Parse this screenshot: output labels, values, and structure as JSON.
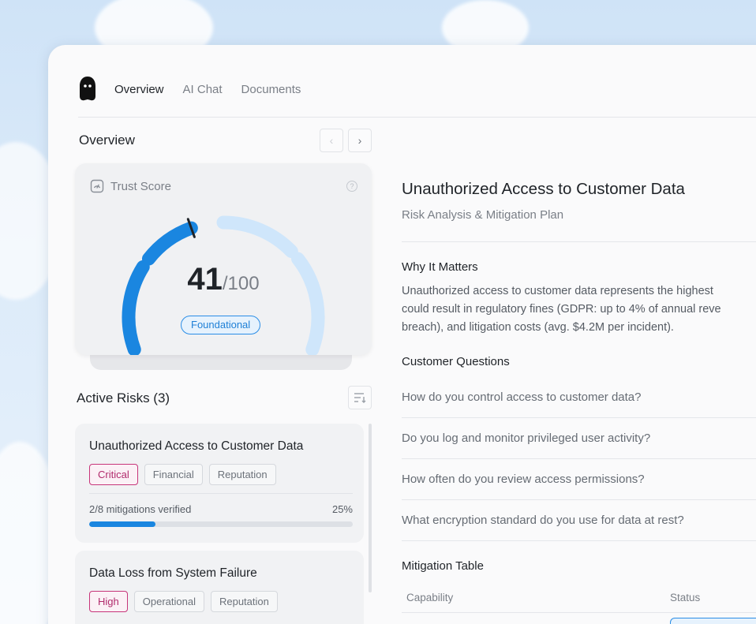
{
  "nav": {
    "logo": "ghost-logo",
    "tabs": [
      {
        "label": "Overview",
        "active": true
      },
      {
        "label": "AI Chat",
        "active": false
      },
      {
        "label": "Documents",
        "active": false
      }
    ]
  },
  "overview": {
    "title": "Overview",
    "trust_score": {
      "label": "Trust Score",
      "score": "41",
      "max": "/100",
      "level": "Foundational",
      "value_fraction": 0.41
    }
  },
  "active_risks": {
    "title": "Active Risks (3)",
    "items": [
      {
        "title": "Unauthorized Access to Customer Data",
        "tags": [
          "Critical",
          "Financial",
          "Reputation"
        ],
        "mitigations": "2/8 mitigations verified",
        "percent": "25%",
        "progress": 0.25
      },
      {
        "title": "Data Loss from System Failure",
        "tags": [
          "High",
          "Operational",
          "Reputation"
        ]
      }
    ]
  },
  "detail": {
    "title": "Unauthorized Access to Customer Data",
    "subtitle": "Risk Analysis & Mitigation Plan",
    "why_heading": "Why It Matters",
    "why_lines": [
      "Unauthorized access to customer data represents the highest",
      "could result in regulatory fines (GDPR: up to 4% of annual reve",
      "breach), and litigation costs (avg. $4.2M per incident)."
    ],
    "questions_heading": "Customer Questions",
    "questions": [
      "How do you control access to customer data?",
      "Do you log and monitor privileged user activity?",
      "How often do you review access permissions?",
      "What encryption standard do you use for data at rest?"
    ],
    "table_heading": "Mitigation Table",
    "table_columns": [
      "Capability",
      "Status"
    ]
  },
  "colors": {
    "accent": "#1a86e0",
    "gauge_active": "#1a86e0",
    "gauge_inactive": "#cfe6fb",
    "critical": "#c7357a"
  }
}
